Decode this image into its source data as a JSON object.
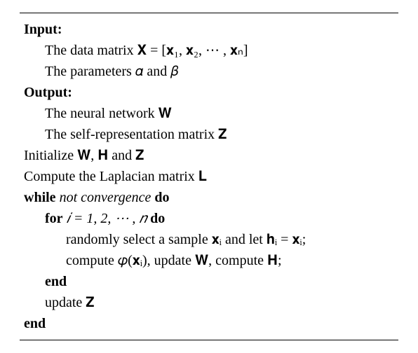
{
  "algo": {
    "input_header": "Input:",
    "input_line1": "The data matrix 𝐗 = [𝐱₁, 𝐱₂, ⋯ , 𝐱ₙ]",
    "input_line2": "The parameters 𝛼 and 𝛽",
    "output_header": "Output:",
    "output_line1": "The neural network 𝐖",
    "output_line2": "The self-representation matrix 𝐙",
    "init_line": "Initialize 𝐖, 𝐇 and 𝐙",
    "compute_line": "Compute the Laplacian matrix 𝐋",
    "while_kw": "while",
    "while_cond": " not convergence ",
    "do_kw": "do",
    "for_kw": "for",
    "for_expr": " 𝑖 = 1, 2, ⋯ , 𝑛 ",
    "for_do": "do",
    "body_line1": "randomly select a sample 𝐱ᵢ and let 𝐡ᵢ = 𝐱ᵢ;",
    "body_line2": "compute 𝜑(𝐱ᵢ), update 𝐖, compute 𝐇;",
    "end1": "end",
    "update_z": "update 𝐙",
    "end2": "end"
  }
}
